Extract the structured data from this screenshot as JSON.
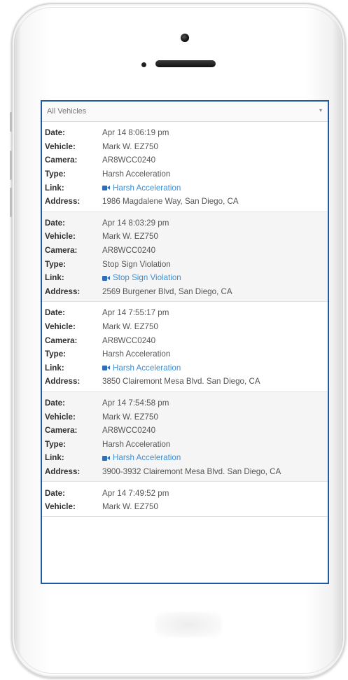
{
  "filter": {
    "selected": "All Vehicles"
  },
  "labels": {
    "date": "Date:",
    "vehicle": "Vehicle:",
    "camera": "Camera:",
    "type": "Type:",
    "link": "Link:",
    "address": "Address:"
  },
  "events": [
    {
      "date": "Apr 14 8:06:19 pm",
      "vehicle": "Mark W. EZ750",
      "camera": "AR8WCC0240",
      "type": "Harsh Acceleration",
      "link": "Harsh Acceleration",
      "address": "1986 Magdalene Way, San Diego, CA"
    },
    {
      "date": "Apr 14 8:03:29 pm",
      "vehicle": "Mark W. EZ750",
      "camera": "AR8WCC0240",
      "type": "Stop Sign Violation",
      "link": "Stop Sign Violation",
      "address": "2569 Burgener Blvd, San Diego, CA"
    },
    {
      "date": "Apr 14 7:55:17 pm",
      "vehicle": "Mark W. EZ750",
      "camera": "AR8WCC0240",
      "type": "Harsh Acceleration",
      "link": "Harsh Acceleration",
      "address": "3850 Clairemont Mesa Blvd. San Diego, CA"
    },
    {
      "date": "Apr 14 7:54:58 pm",
      "vehicle": "Mark W. EZ750",
      "camera": "AR8WCC0240",
      "type": "Harsh Acceleration",
      "link": "Harsh Acceleration",
      "address": "3900-3932 Clairemont Mesa Blvd. San Diego, CA"
    },
    {
      "date": "Apr 14 7:49:52 pm",
      "vehicle": "Mark W. EZ750"
    }
  ],
  "icons": {
    "link": "video-camera-icon",
    "dropdown": "chevron-down-icon"
  },
  "colors": {
    "screen_border": "#1f5aa6",
    "link": "#3d8fd6"
  }
}
